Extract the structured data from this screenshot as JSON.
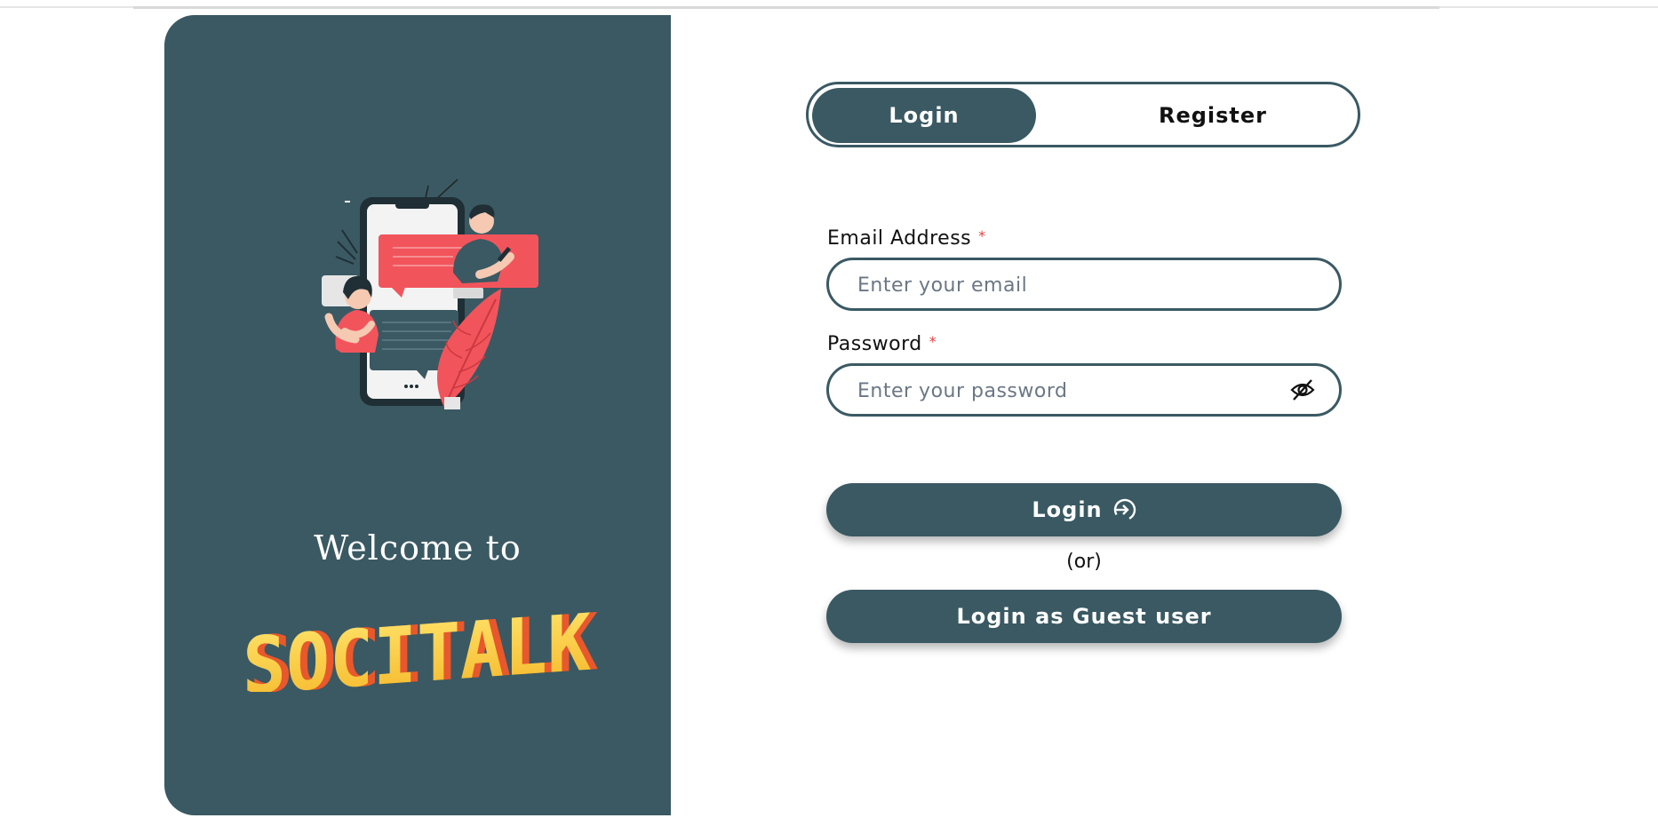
{
  "tabs": {
    "login": "Login",
    "register": "Register"
  },
  "welcome": {
    "text": "Welcome to",
    "brand": "SOCITALK"
  },
  "form": {
    "email_label": "Email Address",
    "email_required": "*",
    "email_placeholder": "Enter your email",
    "password_label": "Password",
    "password_required": "*",
    "password_placeholder": "Enter your password",
    "login_button": "Login",
    "or_text": "(or)",
    "guest_button": "Login as Guest user"
  },
  "colors": {
    "primary": "#3a5963",
    "accent_red": "#f2545b",
    "logo_yellow": "#f7c23a",
    "required_red": "#e53e3e"
  },
  "icons": {
    "password_toggle": "eye-slash-icon",
    "login": "sign-in-icon"
  }
}
